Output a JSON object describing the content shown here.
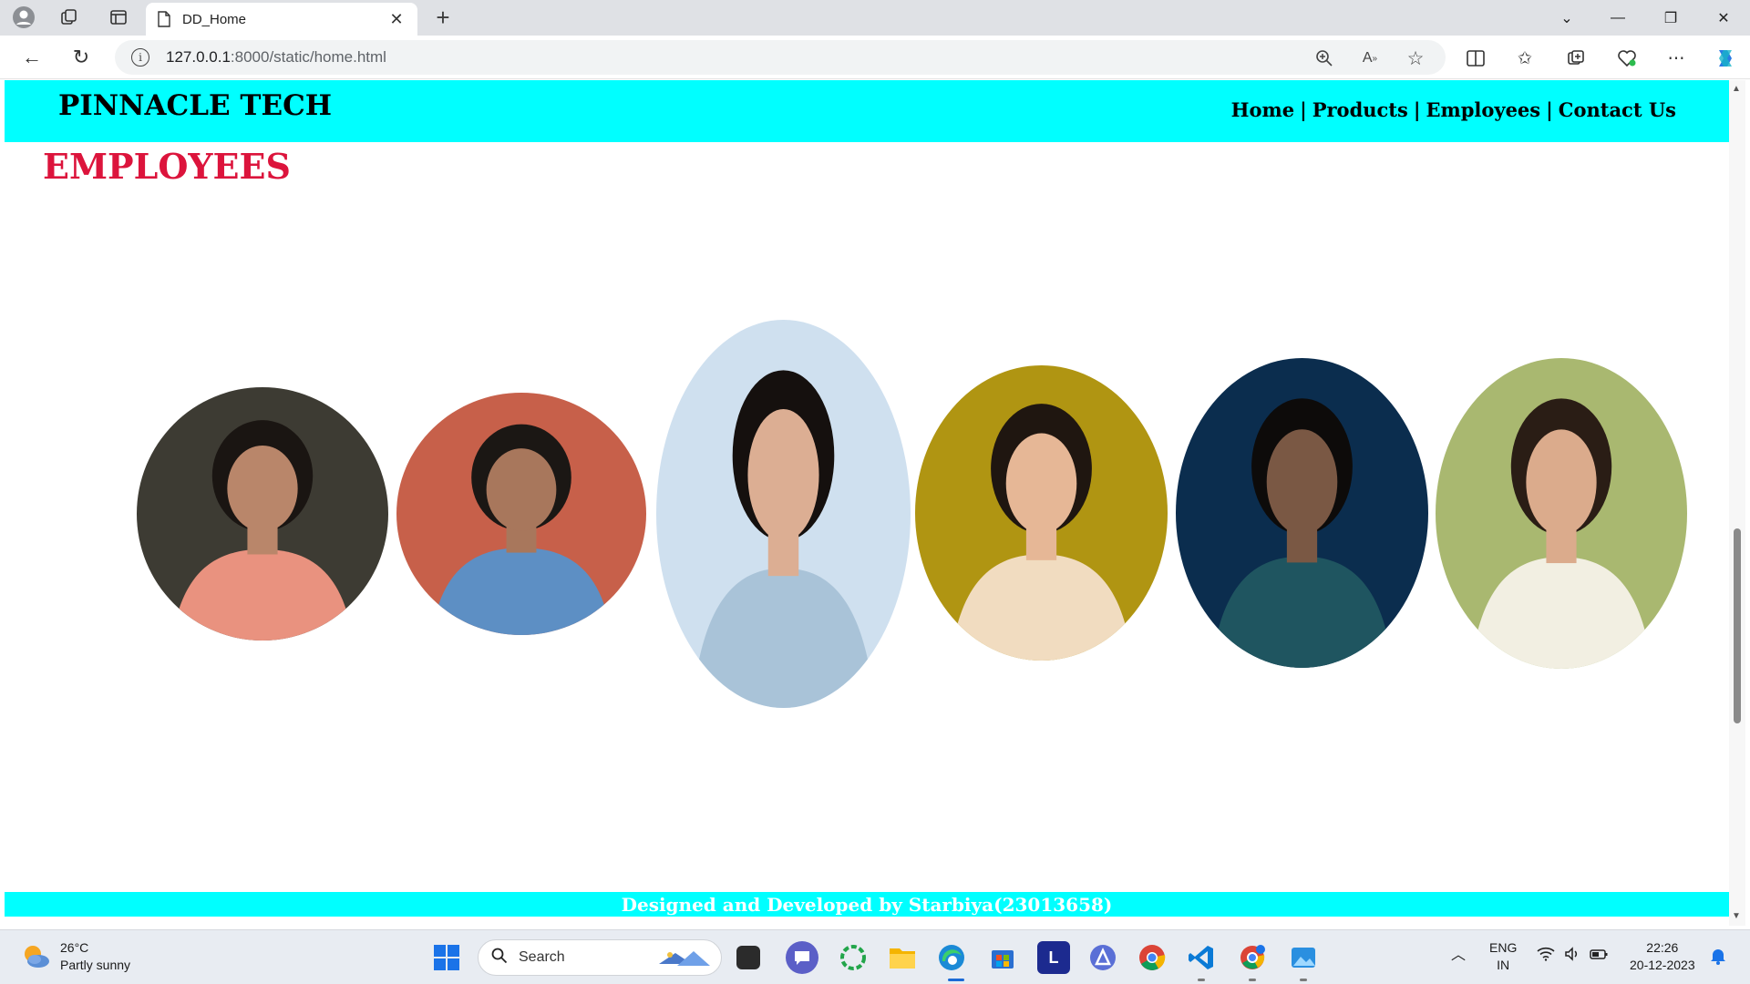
{
  "browser": {
    "tab_title": "DD_Home",
    "url_host": "127.0.0.1",
    "url_rest": ":8000/static/home.html"
  },
  "site": {
    "brand": "PINNACLE TECH",
    "nav": [
      "Home",
      "Products",
      "Employees",
      "Contact Us"
    ],
    "nav_separator": "|",
    "page_title": "EMPLOYEES",
    "footer": "Designed and Developed by Starbiya(23013658)"
  },
  "employees": [
    {
      "photo": "employee-photo-1",
      "bg": "#3d3b33",
      "skin": "#b9866a",
      "shirt": "#e9927f",
      "hair": "#1a1512"
    },
    {
      "photo": "employee-photo-2",
      "bg": "#c7604a",
      "skin": "#a8775c",
      "shirt": "#5d8fc4",
      "hair": "#1b1714"
    },
    {
      "photo": "employee-photo-3",
      "bg": "#cfe0ef",
      "skin": "#dcae93",
      "shirt": "#a9c3d8",
      "hair": "#15100e"
    },
    {
      "photo": "employee-photo-4",
      "bg": "#b09512",
      "skin": "#e6b796",
      "shirt": "#f1dcc0",
      "hair": "#1f1610"
    },
    {
      "photo": "employee-photo-5",
      "bg": "#0b2d4e",
      "skin": "#7a5844",
      "shirt": "#1f5560",
      "hair": "#0d0b0a"
    },
    {
      "photo": "employee-photo-6",
      "bg": "#a9b870",
      "skin": "#dbab8c",
      "shirt": "#f2efe2",
      "hair": "#2a1d15"
    }
  ],
  "taskbar": {
    "temp": "26°C",
    "weather": "Partly sunny",
    "search": "Search",
    "lang": "ENG",
    "region": "IN",
    "time": "22:26",
    "date": "20-12-2023"
  },
  "colors": {
    "header_bg": "#00ffff",
    "title_color": "#dc143c",
    "footer_text": "#ffffff"
  }
}
